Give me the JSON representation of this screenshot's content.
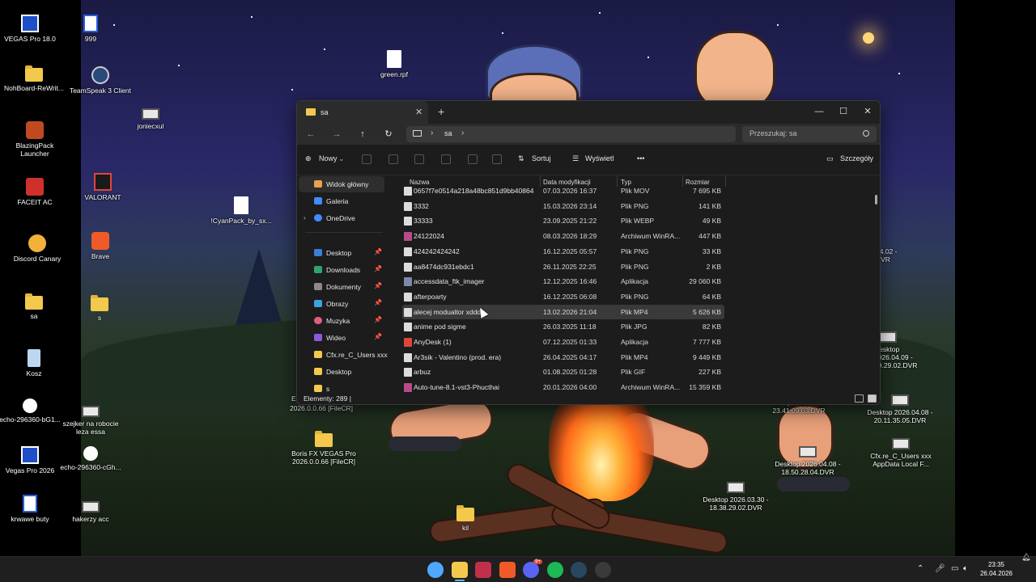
{
  "desktop": {
    "icons": [
      {
        "label": "VEGAS Pro 18.0"
      },
      {
        "label": "999"
      },
      {
        "label": "green.rpf"
      },
      {
        "label": "NohBoard-ReWrit..."
      },
      {
        "label": "TeamSpeak 3 Client"
      },
      {
        "label": "joniecxul"
      },
      {
        "label": "BlazingPack Launcher"
      },
      {
        "label": "FACEIT AC"
      },
      {
        "label": "VALORANT"
      },
      {
        "label": "!CyanPack_by_sx..."
      },
      {
        "label": "Discord Canary"
      },
      {
        "label": "Brave"
      },
      {
        "label": "sa"
      },
      {
        "label": "s"
      },
      {
        "label": "Kosz"
      },
      {
        "label": "echo-296360-bG1..."
      },
      {
        "label": "szejker na robocie leza essa"
      },
      {
        "label": "Vegas Pro 2026"
      },
      {
        "label": "echo-296360-cGh..."
      },
      {
        "label": "krwawe buty"
      },
      {
        "label": "hakerzy acc"
      },
      {
        "label": "Boris FX VEGAS Pro 2026.0.0.66 [FileCR]"
      },
      {
        "label": "kil"
      },
      {
        "label": "04.02 - DVR"
      },
      {
        "label": "Desktop 2026.04.09 - 19.29.02.DVR"
      },
      {
        "label": "Desktop 2026.04.08 - 20.11.35.05.DVR"
      },
      {
        "label": "Desktop 2026.04.11 - 23.41.09.03.DVR"
      },
      {
        "label": "Cfx.re_C_Users xxx AppData Local F..."
      },
      {
        "label": "Desktop 2026.04.08 - 18.50.28.04.DVR"
      },
      {
        "label": "Desktop 2026.03.30 - 18.38.29.02.DVR"
      }
    ],
    "partial_label": "E",
    "partial_label2": "2026.0.0.66 [FileCR]"
  },
  "explorer": {
    "tab_title": "sa",
    "new_tab": "+",
    "controls": {
      "minimize": "—",
      "maximize": "☐",
      "close": "✕"
    },
    "breadcrumb": [
      "sa"
    ],
    "search_placeholder": "Przeszukaj: sa",
    "toolbar": {
      "new_label": "Nowy",
      "sort_label": "Sortuj",
      "view_label": "Wyświetl",
      "more_label": "•••",
      "details_label": "Szczegóły"
    },
    "nav": [
      {
        "label": "Widok główny",
        "color": "#e8a34a",
        "selected": true
      },
      {
        "label": "Galeria",
        "color": "#3f8cff"
      },
      {
        "label": "OneDrive",
        "color": "#3f8cff",
        "expandable": true
      },
      {
        "label": "Desktop",
        "color": "#3a7fd8",
        "pinned": true
      },
      {
        "label": "Downloads",
        "color": "#2fa36b",
        "pinned": true
      },
      {
        "label": "Dokumenty",
        "color": "#8a8a8a",
        "pinned": true
      },
      {
        "label": "Obrazy",
        "color": "#3fa0e0",
        "pinned": true
      },
      {
        "label": "Muzyka",
        "color": "#e0607a",
        "pinned": true
      },
      {
        "label": "Wideo",
        "color": "#8a5ad8",
        "pinned": true
      },
      {
        "label": "Cfx.re_C_Users xxx A",
        "color": "#f2c94c"
      },
      {
        "label": "Desktop",
        "color": "#f2c94c"
      },
      {
        "label": "s",
        "color": "#f2c94c"
      }
    ],
    "columns": {
      "name": "Nazwa",
      "date": "Data modyfikacji",
      "type": "Typ",
      "size": "Rozmiar"
    },
    "files": [
      {
        "name": "0657f7e0514a218a48bc851d9bb40864",
        "date": "07.03.2026 16:37",
        "type": "Plik MOV",
        "size": "7 695 KB",
        "icon_color": "#dcdcdc"
      },
      {
        "name": "3332",
        "date": "15.03.2026 23:14",
        "type": "Plik PNG",
        "size": "141 KB",
        "icon_color": "#dcdcdc"
      },
      {
        "name": "33333",
        "date": "23.09.2025 21:22",
        "type": "Plik WEBP",
        "size": "49 KB",
        "icon_color": "#dcdcdc"
      },
      {
        "name": "24122024",
        "date": "08.03.2026 18:29",
        "type": "Archiwum WinRA...",
        "size": "447 KB",
        "icon_color": "#b84a8a"
      },
      {
        "name": "424242424242",
        "date": "16.12.2025 05:57",
        "type": "Plik PNG",
        "size": "33 KB",
        "icon_color": "#dcdcdc"
      },
      {
        "name": "aa8474dc931ebdc1",
        "date": "26.11.2025 22:25",
        "type": "Plik PNG",
        "size": "2 KB",
        "icon_color": "#dcdcdc"
      },
      {
        "name": "accessdata_ftk_imager",
        "date": "12.12.2025 16:46",
        "type": "Aplikacja",
        "size": "29 060 KB",
        "icon_color": "#7a8aa8"
      },
      {
        "name": "afterpoarty",
        "date": "16.12.2025 06:08",
        "type": "Plik PNG",
        "size": "64 KB",
        "icon_color": "#dcdcdc"
      },
      {
        "name": "alecej modualtor xddd",
        "date": "13.02.2026 21:04",
        "type": "Plik MP4",
        "size": "5 626 KB",
        "icon_color": "#dcdcdc",
        "selected": true
      },
      {
        "name": "anime pod sigme",
        "date": "26.03.2025 11:18",
        "type": "Plik JPG",
        "size": "82 KB",
        "icon_color": "#dcdcdc"
      },
      {
        "name": "AnyDesk (1)",
        "date": "07.12.2025 01:33",
        "type": "Aplikacja",
        "size": "7 777 KB",
        "icon_color": "#e0453a"
      },
      {
        "name": "Ar3sik - Valentino (prod. era)",
        "date": "26.04.2025 04:17",
        "type": "Plik MP4",
        "size": "9 449 KB",
        "icon_color": "#dcdcdc"
      },
      {
        "name": "arbuz",
        "date": "01.08.2025 01:28",
        "type": "Plik GIF",
        "size": "227 KB",
        "icon_color": "#dcdcdc"
      },
      {
        "name": "Auto-tune-8.1-vst3-Phucthai",
        "date": "20.01.2026 04:00",
        "type": "Archiwum WinRA...",
        "size": "15 359 KB",
        "icon_color": "#b84a8a"
      }
    ],
    "status": "Elementy: 289  |"
  },
  "taskbar": {
    "apps": [
      {
        "name": "start-icon",
        "color": "#4fa8ff"
      },
      {
        "name": "file-explorer-icon",
        "color": "#f2c94c",
        "active": true
      },
      {
        "name": "affinity-icon",
        "color": "#c0304a"
      },
      {
        "name": "brave-icon",
        "color": "#f05a28"
      },
      {
        "name": "discord-icon",
        "color": "#5865f2"
      },
      {
        "name": "spotify-icon",
        "color": "#1db954"
      },
      {
        "name": "steam-icon",
        "color": "#2a475e"
      },
      {
        "name": "obs-icon",
        "color": "#3a3a3a"
      }
    ],
    "discord_badge": "9+",
    "time": "23:35",
    "date": "26.04.2026"
  }
}
